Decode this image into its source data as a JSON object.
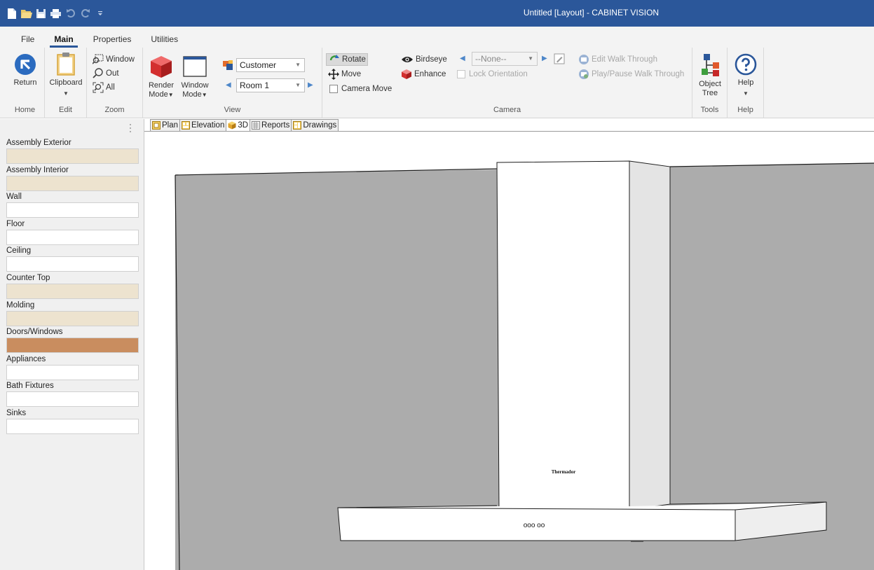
{
  "window": {
    "title": "Untitled [Layout] - CABINET VISION"
  },
  "quick_access": {
    "icons": [
      "new-file-icon",
      "open-folder-icon",
      "save-icon",
      "print-icon",
      "undo-icon",
      "redo-icon",
      "customize-icon"
    ]
  },
  "ribbon": {
    "tabs": [
      {
        "label": "File"
      },
      {
        "label": "Main"
      },
      {
        "label": "Properties"
      },
      {
        "label": "Utilities"
      }
    ],
    "active_tab": "Main",
    "home": {
      "group_label": "Home",
      "return_label": "Return"
    },
    "edit": {
      "group_label": "Edit",
      "clipboard_label": "Clipboard"
    },
    "zoom": {
      "group_label": "Zoom",
      "window_label": "Window",
      "out_label": "Out",
      "all_label": "All"
    },
    "view": {
      "group_label": "View",
      "render_mode_line1": "Render",
      "render_mode_line2": "Mode",
      "window_mode_line1": "Window",
      "window_mode_line2": "Mode",
      "customer_value": "Customer",
      "room_value": "Room 1"
    },
    "camera": {
      "group_label": "Camera",
      "rotate_label": "Rotate",
      "move_label": "Move",
      "camera_move_label": "Camera Move",
      "birdseye_label": "Birdseye",
      "enhance_label": "Enhance",
      "none_value": "--None--",
      "lock_orientation_label": "Lock Orientation",
      "edit_walk_label": "Edit Walk Through",
      "play_walk_label": "Play/Pause Walk Through"
    },
    "tools": {
      "group_label": "Tools",
      "object_tree_line1": "Object",
      "object_tree_line2": "Tree"
    },
    "help": {
      "group_label": "Help",
      "help_label": "Help"
    }
  },
  "left_panel": {
    "materials": [
      {
        "label": "Assembly Exterior",
        "color": "#ede3cf"
      },
      {
        "label": "Assembly Interior",
        "color": "#ede3cf"
      },
      {
        "label": "Wall",
        "color": "#ffffff"
      },
      {
        "label": "Floor",
        "color": "#ffffff"
      },
      {
        "label": "Ceiling",
        "color": "#ffffff"
      },
      {
        "label": "Counter Top",
        "color": "#ede3cf"
      },
      {
        "label": "Molding",
        "color": "#ede3cf"
      },
      {
        "label": "Doors/Windows",
        "color": "#c98d5f"
      },
      {
        "label": "Appliances",
        "color": "#ffffff"
      },
      {
        "label": "Bath Fixtures",
        "color": "#ffffff"
      },
      {
        "label": "Sinks",
        "color": "#ffffff"
      }
    ]
  },
  "view_tabs": [
    {
      "label": "Plan",
      "icon": "plan-icon"
    },
    {
      "label": "Elevation",
      "icon": "elevation-icon"
    },
    {
      "label": "3D",
      "icon": "cube-3d-icon"
    },
    {
      "label": "Reports",
      "icon": "reports-icon"
    },
    {
      "label": "Drawings",
      "icon": "drawings-icon"
    }
  ],
  "active_view": "3D",
  "scene": {
    "brand_text": "Thermador",
    "controls_text": "ooo oo"
  }
}
